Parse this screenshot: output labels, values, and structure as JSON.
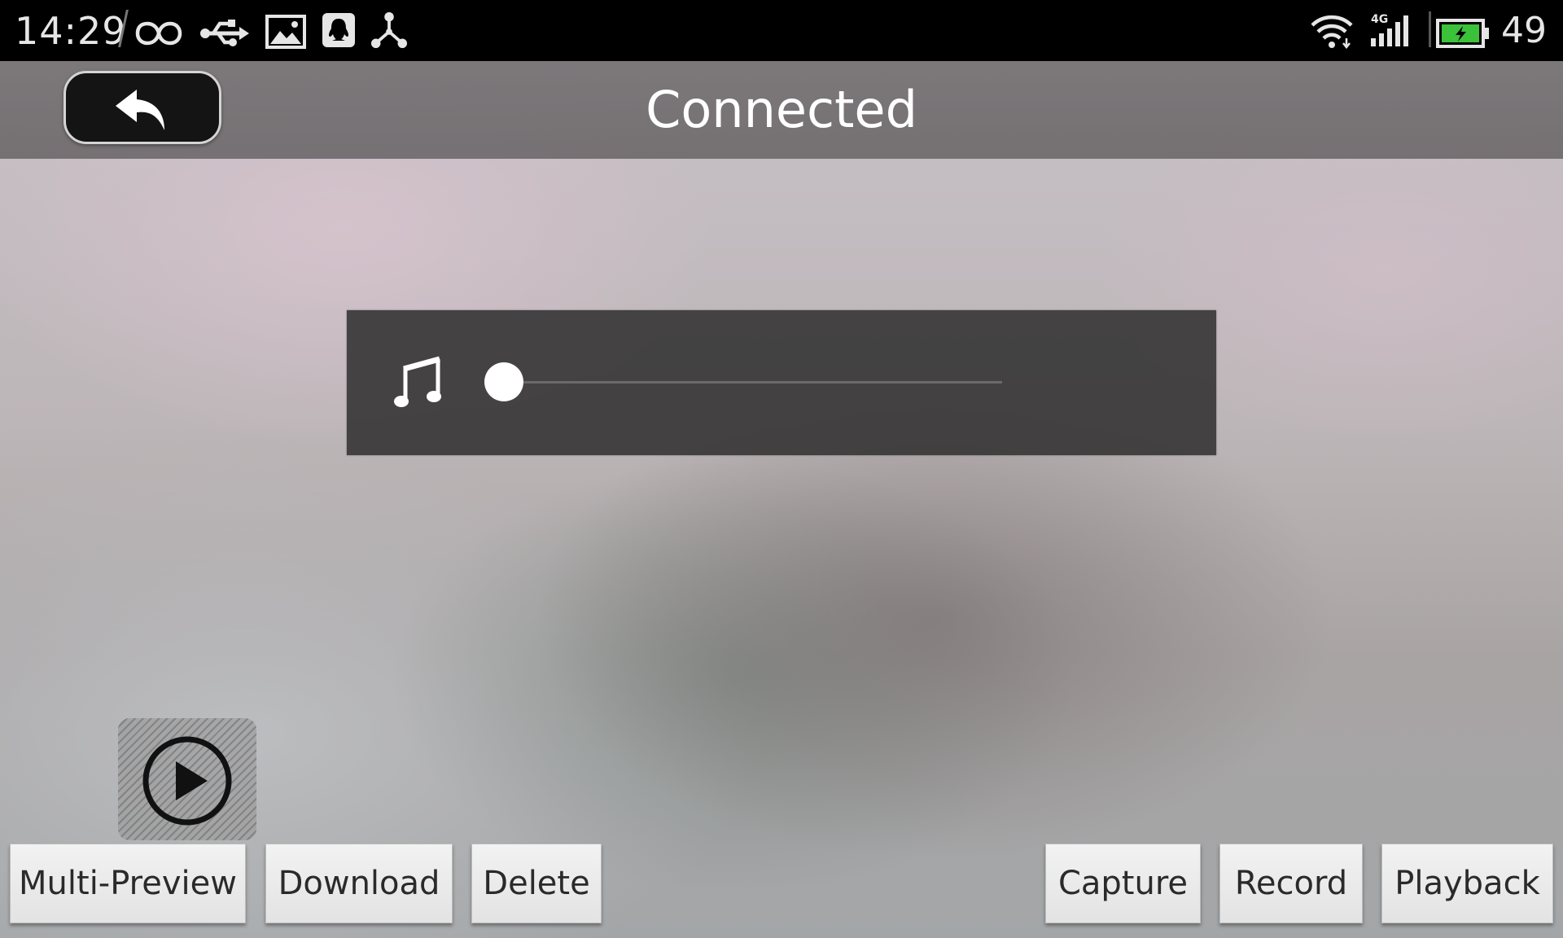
{
  "status_bar": {
    "time": "14:29",
    "battery_level": "49",
    "icons": [
      "infinity-icon",
      "usb-icon",
      "image-icon",
      "qq-icon",
      "network-share-icon",
      "wifi-icon",
      "signal-4g-icon",
      "battery-charging-icon"
    ],
    "network_type": "4G",
    "battery_color": "#3cc13a"
  },
  "header": {
    "title": "Connected",
    "back_icon": "back-arrow-icon"
  },
  "audio_panel": {
    "icon": "music-note-icon",
    "volume_position": 0
  },
  "play_button": {
    "icon": "play-icon"
  },
  "toolbar": {
    "left_buttons": [
      "Multi-Preview",
      "Download",
      "Delete"
    ],
    "right_buttons": [
      "Capture",
      "Record",
      "Playback"
    ]
  }
}
